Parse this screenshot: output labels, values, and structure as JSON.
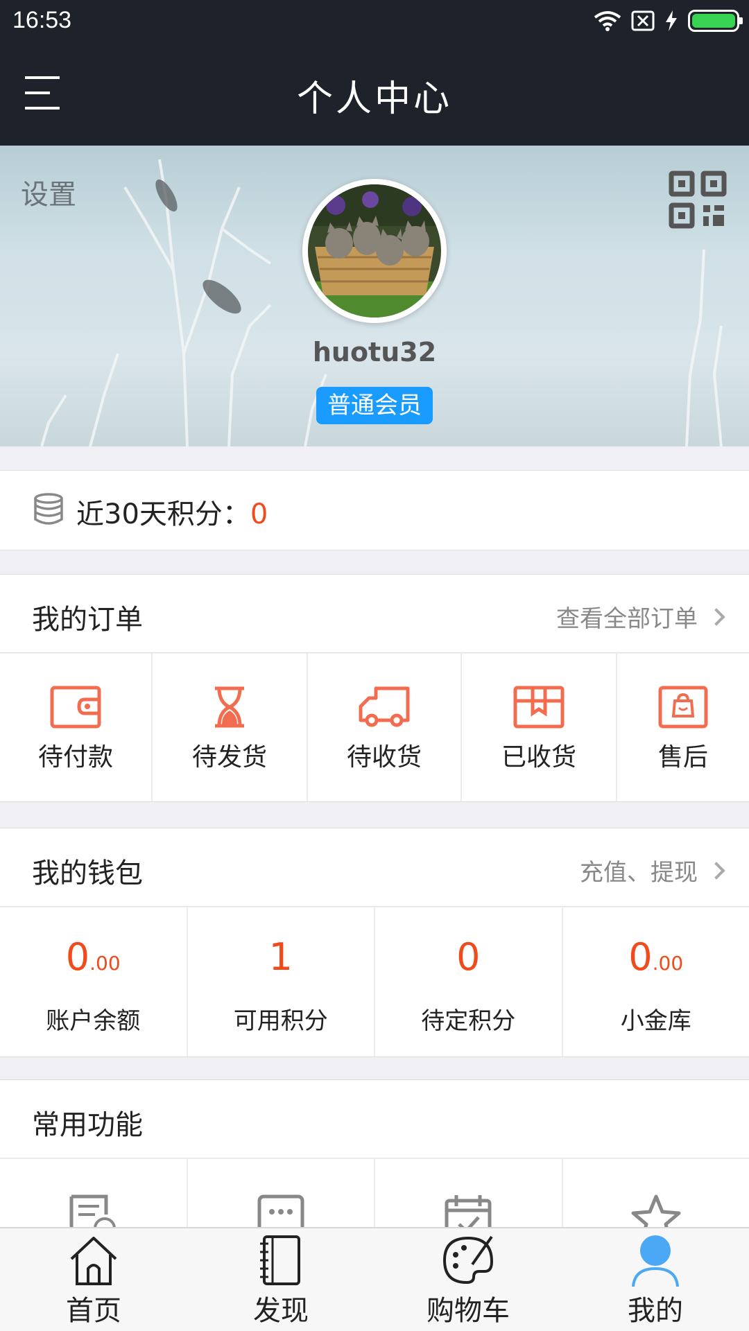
{
  "status_bar": {
    "time": "16:53",
    "icons": [
      "wifi-icon",
      "sim-off-icon",
      "charging-icon",
      "battery-icon"
    ]
  },
  "nav": {
    "title": "个人中心",
    "menu_icon": "menu-icon"
  },
  "profile": {
    "settings_label": "设置",
    "username": "huotu32",
    "member_level": "普通会员",
    "qr_icon": "qr-code-icon"
  },
  "points": {
    "label": "近30天积分：",
    "value": "0"
  },
  "orders": {
    "title": "我的订单",
    "more": "查看全部订单",
    "items": [
      {
        "label": "待付款",
        "icon": "wallet-icon"
      },
      {
        "label": "待发货",
        "icon": "hourglass-icon"
      },
      {
        "label": "待收货",
        "icon": "truck-icon"
      },
      {
        "label": "已收货",
        "icon": "box-icon"
      },
      {
        "label": "售后",
        "icon": "bag-icon"
      }
    ]
  },
  "wallet": {
    "title": "我的钱包",
    "more": "充值、提现",
    "items": [
      {
        "int": "0",
        "dec": ".00",
        "label": "账户余额"
      },
      {
        "int": "1",
        "dec": "",
        "label": "可用积分"
      },
      {
        "int": "0",
        "dec": "",
        "label": "待定积分"
      },
      {
        "int": "0",
        "dec": ".00",
        "label": "小金库"
      }
    ]
  },
  "functions": {
    "title": "常用功能",
    "items": [
      {
        "icon": "edit-document-icon"
      },
      {
        "icon": "message-icon"
      },
      {
        "icon": "calendar-check-icon"
      },
      {
        "icon": "star-icon"
      }
    ]
  },
  "tabbar": {
    "items": [
      {
        "label": "首页",
        "icon": "home-icon"
      },
      {
        "label": "发现",
        "icon": "notebook-icon"
      },
      {
        "label": "购物车",
        "icon": "palette-icon"
      },
      {
        "label": "我的",
        "icon": "user-icon"
      }
    ],
    "active_color": "#4aa8f5"
  },
  "colors": {
    "accent": "#f04b1b",
    "dark": "#1e232b",
    "badge": "#1a9bff",
    "icon_orange": "#f26d4f"
  }
}
